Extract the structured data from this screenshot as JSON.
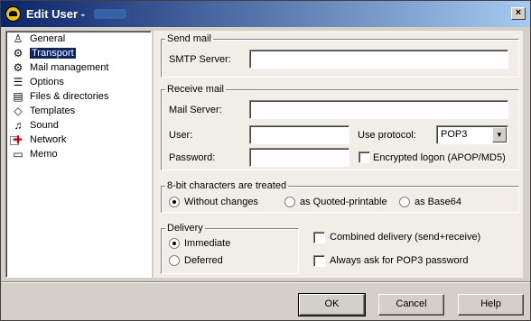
{
  "window": {
    "title": "Edit User -"
  },
  "tree": {
    "items": [
      {
        "label": "General",
        "icon": "person-icon"
      },
      {
        "label": "Transport",
        "icon": "gear-icon",
        "selected": true
      },
      {
        "label": "Mail management",
        "icon": "gear-icon"
      },
      {
        "label": "Options",
        "icon": "options-icon"
      },
      {
        "label": "Files & directories",
        "icon": "files-icon"
      },
      {
        "label": "Templates",
        "icon": "templates-icon"
      },
      {
        "label": "Sound",
        "icon": "music-note-icon"
      },
      {
        "label": "Network",
        "icon": "network-icon"
      },
      {
        "label": "Memo",
        "icon": "memo-icon"
      }
    ]
  },
  "send_mail": {
    "legend": "Send mail",
    "smtp_label": "SMTP Server:",
    "smtp_value": ""
  },
  "receive_mail": {
    "legend": "Receive mail",
    "mail_server_label": "Mail Server:",
    "mail_server_value": "",
    "user_label": "User:",
    "user_value": "",
    "password_label": "Password:",
    "password_value": "",
    "protocol_label": "Use protocol:",
    "protocol_value": "POP3",
    "encrypted_label": "Encrypted logon (APOP/MD5)",
    "encrypted_checked": false
  },
  "eight_bit": {
    "legend": "8-bit characters are treated",
    "options": [
      "Without changes",
      "as Quoted-printable",
      "as Base64"
    ],
    "selected": "Without changes"
  },
  "delivery": {
    "legend": "Delivery",
    "options": [
      "Immediate",
      "Deferred"
    ],
    "selected": "Immediate"
  },
  "checkboxes": {
    "combined": "Combined delivery (send+receive)",
    "always_ask": "Always ask for POP3 password"
  },
  "buttons": {
    "ok": "OK",
    "cancel": "Cancel",
    "help": "Help"
  }
}
